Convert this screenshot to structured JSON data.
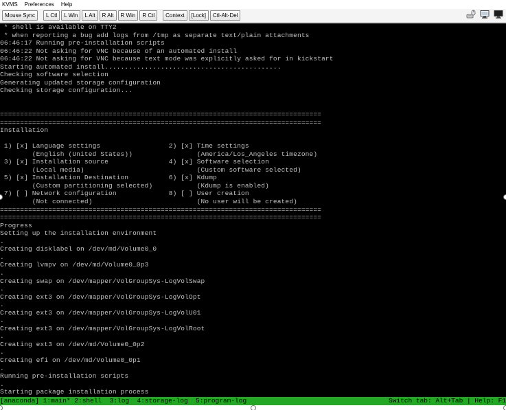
{
  "menu": [
    "KVMS",
    "Preferences",
    "Help"
  ],
  "toolbar": {
    "buttons": [
      "Mouse Sync",
      "L Ctl",
      "L Win",
      "L Alt",
      "R Alt",
      "R Win",
      "R Ctl",
      "Context",
      "[Lock]",
      "Ctl-Alt-Del"
    ]
  },
  "tray_icons": [
    "keyboard-mouse-icon",
    "monitor-icon",
    "display-icon"
  ],
  "console": {
    "lines": [
      " * shell is available on TTY2",
      " * when reporting a bug add logs from /tmp as separate text/plain attachments",
      "06:46:17 Running pre-installation scripts",
      "06:46:22 Not asking for VNC because of an automated install",
      "06:46:22 Not asking for VNC because text mode was explicitly asked for in kickstart",
      "Starting automated install............................................",
      "Checking software selection",
      "Generating updated storage configuration",
      "Checking storage configuration...",
      "",
      "",
      "================================================================================",
      "================================================================================",
      "Installation",
      "",
      " 1) [x] Language settings                 2) [x] Time settings",
      "        (English (United States))                (America/Los_Angeles timezone)",
      " 3) [x] Installation source               4) [x] Software selection",
      "        (Local media)                            (Custom software selected)",
      " 5) [x] Installation Destination          6) [x] Kdump",
      "        (Custom partitioning selected)           (Kdump is enabled)",
      " 7) [ ] Network configuration             8) [ ] User creation",
      "        (Not connected)                          (No user will be created)",
      "================================================================================",
      "================================================================================",
      "Progress",
      "Setting up the installation environment",
      ".",
      "Creating disklabel on /dev/md/Volume0_0",
      ".",
      "Creating lvmpv on /dev/md/Volume0_0p3",
      ".",
      "Creating swap on /dev/mapper/VolGroupSys-LogVolSwap",
      ".",
      "Creating ext3 on /dev/mapper/VolGroupSys-LogVolOpt",
      ".",
      "Creating ext3 on /dev/mapper/VolGroupSys-LogVolU01",
      ".",
      "Creating ext3 on /dev/mapper/VolGroupSys-LogVolRoot",
      ".",
      "Creating ext3 on /dev/md/Volume0_0p2",
      ".",
      "Creating efi on /dev/md/Volume0_0p1",
      ".",
      "Running pre-installation scripts",
      ".",
      "Starting package installation process",
      ""
    ]
  },
  "statusbar": {
    "left": "[anaconda] 1:main* 2:shell  3:log  4:storage-log  5:program-log",
    "right": "Switch tab: Alt+Tab | Help: F1"
  }
}
